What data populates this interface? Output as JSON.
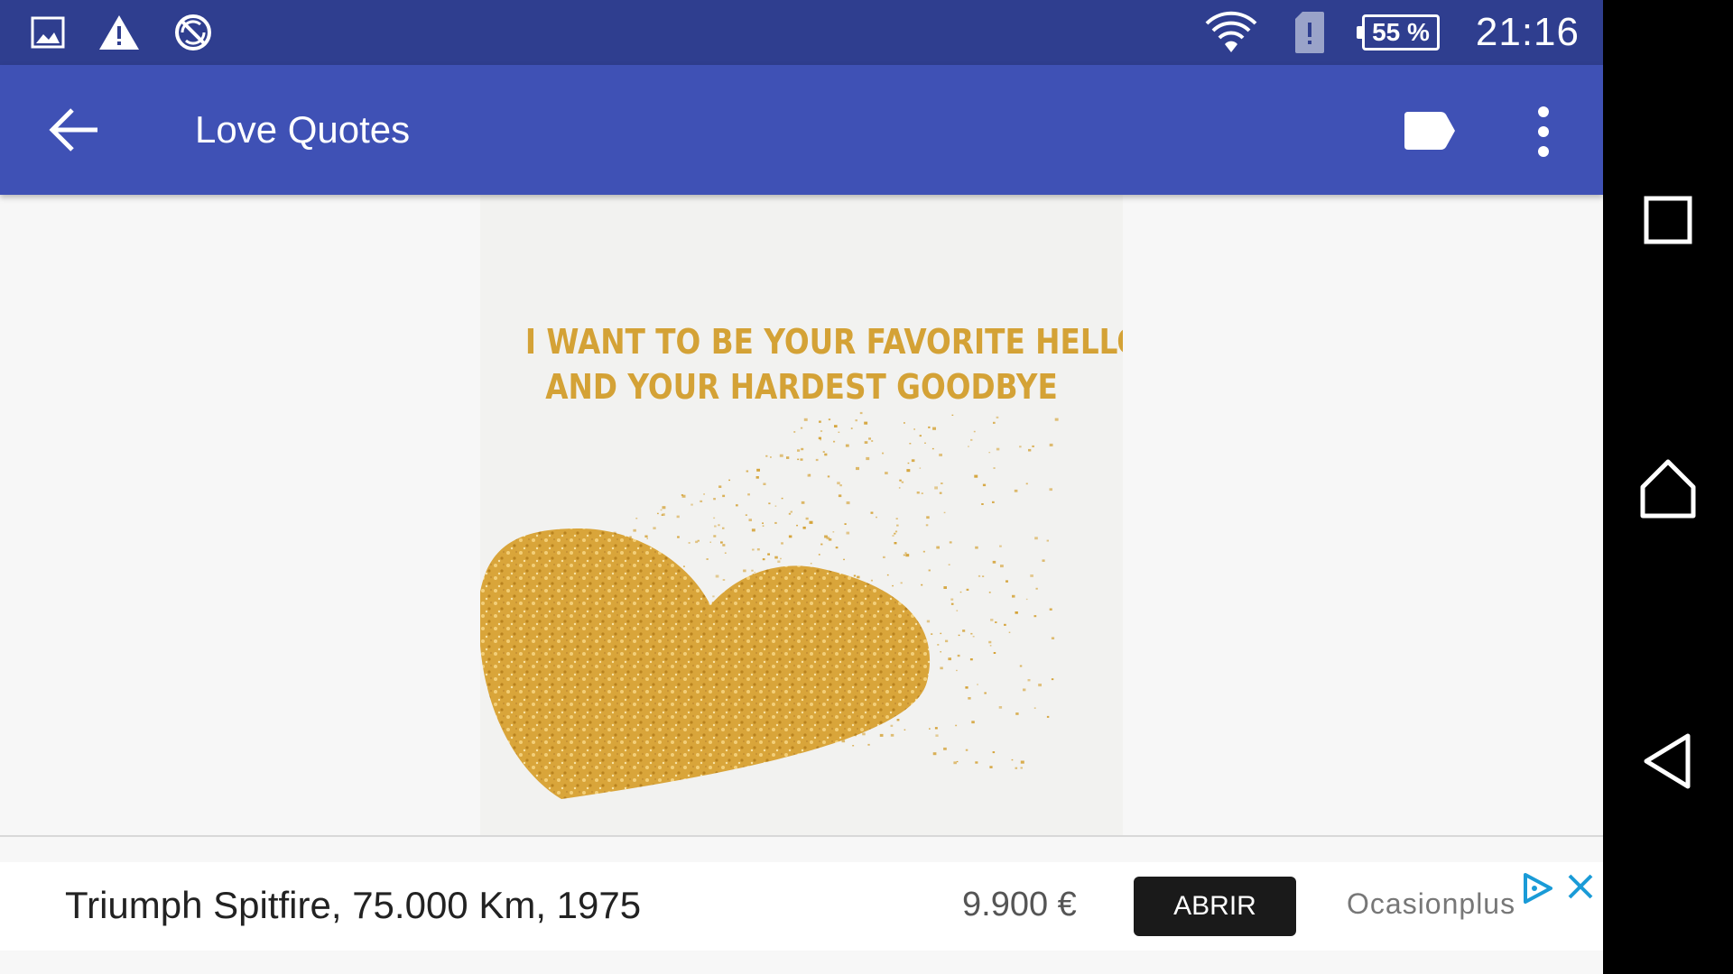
{
  "status_bar": {
    "icons": [
      "gallery-icon",
      "warning-icon",
      "no-sync-icon",
      "wifi-icon",
      "sim-alert-icon"
    ],
    "battery": "55 %",
    "time": "21:16"
  },
  "app_bar": {
    "title": "Love Quotes",
    "icons": [
      "back-arrow-icon",
      "label-icon",
      "more-vert-icon"
    ]
  },
  "quote": {
    "line1": "I WANT TO BE YOUR FAVORITE HELLO",
    "line2": "AND YOUR HARDEST GOODBYE",
    "accent_color": "#d4a236"
  },
  "ad": {
    "title": "Triumph Spitfire, 75.000 Km, 1975",
    "price": "9.900 €",
    "cta": "ABRIR",
    "advertiser": "Ocasionplus",
    "icons": [
      "adchoices-icon",
      "close-icon"
    ],
    "accent_color": "#1a9bd7"
  },
  "nav_bar": {
    "icons": [
      "recents-icon",
      "home-icon",
      "back-icon"
    ]
  },
  "colors": {
    "status_bar": "#2f3e8f",
    "app_bar": "#3f51b5",
    "content_bg": "#f7f7f7"
  }
}
